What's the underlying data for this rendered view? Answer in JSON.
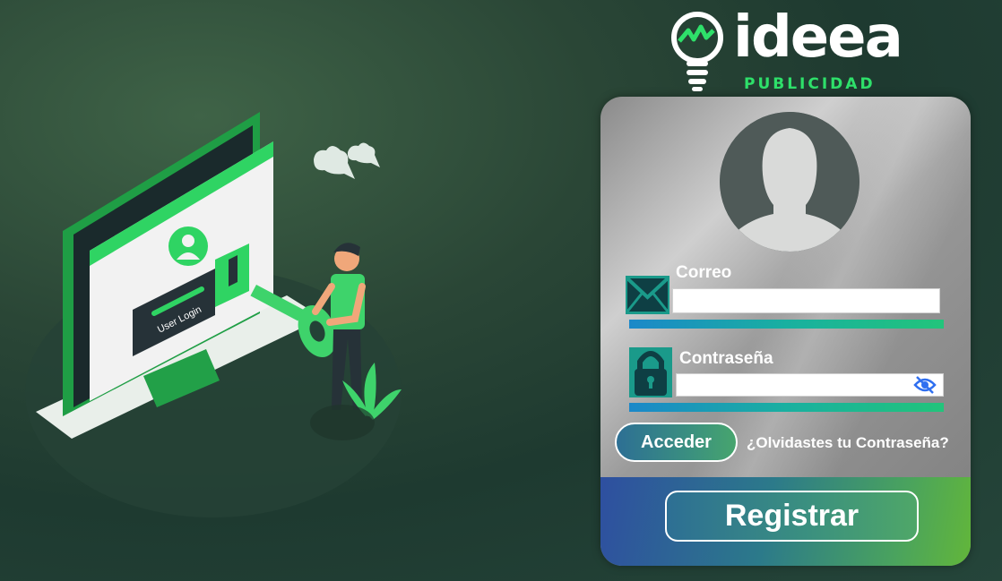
{
  "brand": {
    "name": "ideea",
    "tagline": "PUBLICIDAD"
  },
  "illustration": {
    "screen_label": "User Login"
  },
  "login": {
    "email_label": "Correo",
    "email_value": "",
    "password_label": "Contraseña",
    "password_value": "",
    "submit_label": "Acceder",
    "forgot_label": "¿Olvidastes tu Contraseña?",
    "register_label": "Registrar"
  },
  "colors": {
    "brand_green": "#2ee06a",
    "accent_teal": "#19b0a0",
    "accent_blue": "#1b88c9",
    "icon_teal": "#1a9a8a"
  },
  "icons": [
    "mail-icon",
    "lock-icon",
    "eye-slash-icon",
    "avatar-silhouette-icon",
    "lightbulb-logo-icon"
  ]
}
